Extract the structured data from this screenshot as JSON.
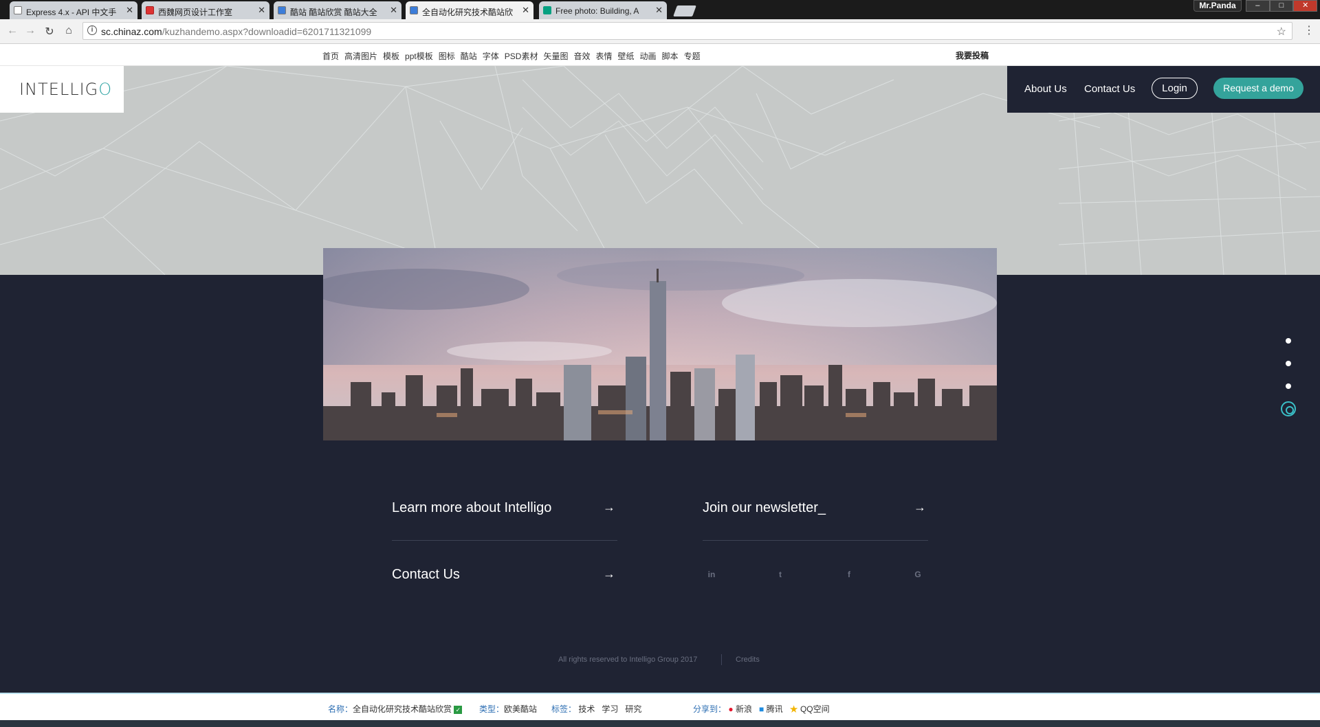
{
  "browser": {
    "tabs": [
      {
        "title": "Express 4.x - API 中文手"
      },
      {
        "title": "西魏网页设计工作室"
      },
      {
        "title": "酷站 酷站欣赏 酷站大全"
      },
      {
        "title": "全自动化研究技术酷站欣"
      },
      {
        "title": "Free photo: Building, A"
      }
    ],
    "profile": "Mr.Panda",
    "url_host": "sc.chinaz.com",
    "url_path": "/kuzhandemo.aspx?downloadid=6201711321099"
  },
  "sitebar": {
    "links": [
      "首页",
      "高清图片",
      "模板",
      "ppt模板",
      "图标",
      "酷站",
      "字体",
      "PSD素材",
      "矢量图",
      "音效",
      "表情",
      "壁纸",
      "动画",
      "脚本",
      "专题"
    ],
    "contribute": "我要投稿"
  },
  "site": {
    "logo_main": "INTELLIG",
    "logo_end": "O",
    "nav": {
      "about": "About Us",
      "contact": "Contact Us",
      "login": "Login",
      "demo": "Request a demo"
    },
    "cta": {
      "learn": "Learn more about Intelligo",
      "newsletter": "Join our newsletter_",
      "contact": "Contact Us",
      "arrow": "→"
    },
    "social": [
      "linkedin-icon",
      "twitter-icon",
      "facebook-icon",
      "google-icon"
    ],
    "social_glyphs": [
      "in",
      "t",
      "f",
      "G"
    ],
    "footer": {
      "copyright": "All rights reserved to Intelligo Group 2017",
      "credits": "Credits"
    },
    "accent_color": "#34a39b",
    "dark_bg": "#1f2333"
  },
  "infobar": {
    "name_label": "名称：",
    "name_value": "全自动化研究技术酷站欣赏",
    "type_label": "类型：",
    "type_value": "欧美酷站",
    "tags_label": "标签：",
    "tags": [
      "技术",
      "学习",
      "研究"
    ],
    "share_label": "分享到：",
    "share": [
      "新浪",
      "腾讯",
      "QQ空间"
    ]
  }
}
